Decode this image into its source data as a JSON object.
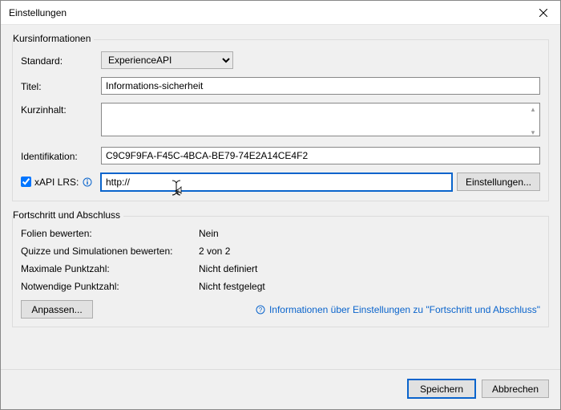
{
  "window": {
    "title": "Einstellungen"
  },
  "groups": {
    "course": {
      "title": "Kursinformationen"
    },
    "progress": {
      "title": "Fortschritt und Abschluss"
    }
  },
  "labels": {
    "standard": "Standard:",
    "title": "Titel:",
    "summary": "Kurzinhalt:",
    "identifier": "Identifikation:",
    "xapi_lrs": "xAPI LRS:",
    "settings_btn": "Einstellungen...",
    "anpassen_btn": "Anpassen...",
    "save": "Speichern",
    "cancel": "Abbrechen"
  },
  "values": {
    "standard_selected": "ExperienceAPI",
    "title_val": "Informations-sicherheit",
    "summary_val": "",
    "identifier_val": "C9C9F9FA-F45C-4BCA-BE79-74E2A14CE4F2",
    "lrs_val": "http://"
  },
  "progress": {
    "slides_label": "Folien bewerten:",
    "slides_val": "Nein",
    "quizzes_label": "Quizze und Simulationen bewerten:",
    "quizzes_val": "2 von 2",
    "maxscore_label": "Maximale Punktzahl:",
    "maxscore_val": "Nicht definiert",
    "reqscore_label": "Notwendige Punktzahl:",
    "reqscore_val": "Nicht festgelegt"
  },
  "help": {
    "text": "Informationen über Einstellungen zu \"Fortschritt und Abschluss\""
  }
}
